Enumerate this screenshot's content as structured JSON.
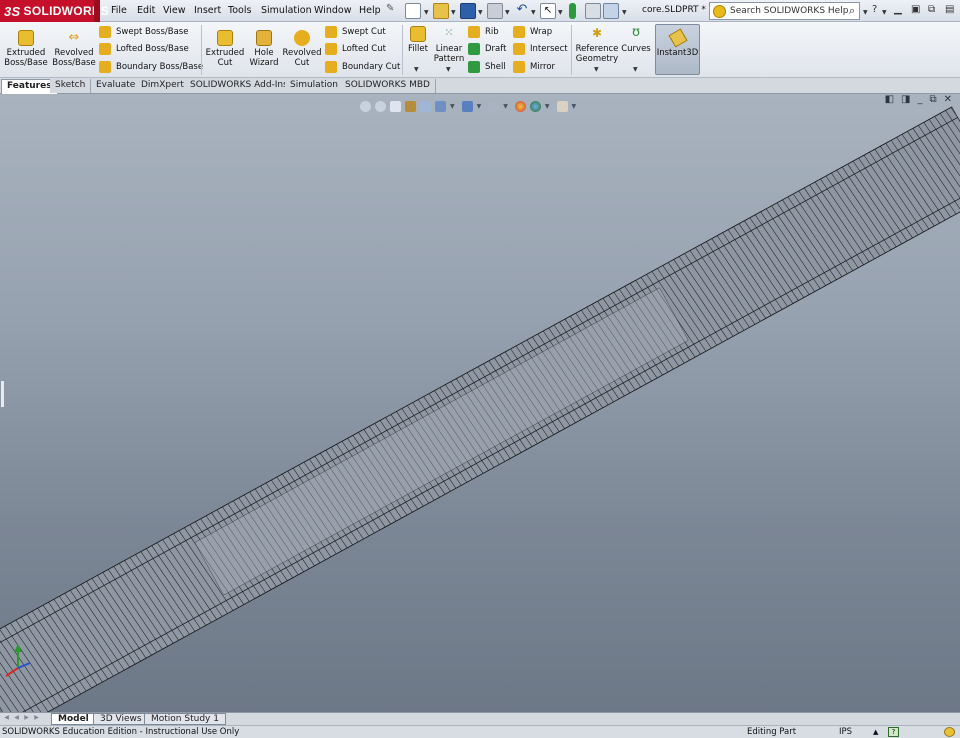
{
  "app": {
    "brand_mark": "3S",
    "brand_name": "SOLIDWORKS",
    "document_title": "core.SLDPRT *"
  },
  "menu": [
    "File",
    "Edit",
    "View",
    "Insert",
    "Tools",
    "Simulation",
    "Window",
    "Help"
  ],
  "search": {
    "placeholder": "Search SOLIDWORKS Help"
  },
  "toolbar": {
    "extruded_boss": "Extruded\nBoss/Base",
    "revolved_boss": "Revolved\nBoss/Base",
    "swept_boss": "Swept Boss/Base",
    "lofted_boss": "Lofted Boss/Base",
    "boundary_boss": "Boundary Boss/Base",
    "extruded_cut": "Extruded\nCut",
    "hole_wizard": "Hole\nWizard",
    "revolved_cut": "Revolved\nCut",
    "swept_cut": "Swept Cut",
    "lofted_cut": "Lofted Cut",
    "boundary_cut": "Boundary Cut",
    "fillet": "Fillet",
    "linear_pattern": "Linear\nPattern",
    "rib": "Rib",
    "draft": "Draft",
    "shell": "Shell",
    "wrap": "Wrap",
    "intersect": "Intersect",
    "mirror": "Mirror",
    "reference_geometry": "Reference\nGeometry",
    "curves": "Curves",
    "instant3d": "Instant3D"
  },
  "tabs": [
    "Features",
    "Sketch",
    "Evaluate",
    "DimXpert",
    "SOLIDWORKS Add-Ins",
    "Simulation",
    "SOLIDWORKS MBD"
  ],
  "active_tab": "Features",
  "model_tabs": [
    "Model",
    "3D Views",
    "Motion Study 1"
  ],
  "active_model_tab": "Model",
  "status": {
    "edition": "SOLIDWORKS Education Edition - Instructional Use Only",
    "mode": "Editing Part",
    "units": "IPS"
  },
  "colors": {
    "brand_red": "#c4102a",
    "viewport_top": "#a9b3bf",
    "viewport_bottom": "#6d7887",
    "model_fill": "#8f97a3"
  },
  "icons": [
    "help-search-icon",
    "magnifier-icon",
    "new-document-icon",
    "open-icon",
    "save-icon",
    "print-icon",
    "undo-icon",
    "select-icon",
    "rebuild-icon",
    "options-icon",
    "question-icon"
  ]
}
